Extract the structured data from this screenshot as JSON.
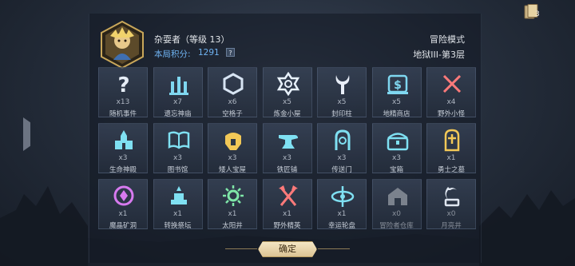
{
  "player": {
    "name": "杂耍者（等级 13）",
    "score_label": "本局积分:",
    "score_value": "1291",
    "help": "?"
  },
  "mode": {
    "title": "冒险模式",
    "floor": "地狱III-第3层"
  },
  "cards": {
    "count": "3"
  },
  "tiles": [
    {
      "count": "x13",
      "label": "随机事件",
      "icon": "question-icon",
      "color": "#e6edf6"
    },
    {
      "count": "x7",
      "label": "遗忘神庙",
      "icon": "temple-icon",
      "color": "#7fd7f0"
    },
    {
      "count": "x6",
      "label": "空格子",
      "icon": "hexagon-icon",
      "color": "#d7e4f3"
    },
    {
      "count": "x5",
      "label": "炼金小屋",
      "icon": "alchemy-icon",
      "color": "#e8f1fb"
    },
    {
      "count": "x5",
      "label": "封印柱",
      "icon": "seal-pillar-icon",
      "color": "#e8eef8"
    },
    {
      "count": "x5",
      "label": "地精商店",
      "icon": "shop-icon",
      "color": "#7fd7f0"
    },
    {
      "count": "x4",
      "label": "野外小怪",
      "icon": "crossed-swords-icon",
      "color": "#ff7a7a"
    },
    {
      "count": "x3",
      "label": "生命神殿",
      "icon": "life-shrine-icon",
      "color": "#7fe0f2"
    },
    {
      "count": "x3",
      "label": "图书馆",
      "icon": "library-icon",
      "color": "#7fe0f2"
    },
    {
      "count": "x3",
      "label": "矮人宝屋",
      "icon": "dwarf-helmet-icon",
      "color": "#f2c857"
    },
    {
      "count": "x3",
      "label": "铁匠铺",
      "icon": "anvil-icon",
      "color": "#7fe0f2"
    },
    {
      "count": "x3",
      "label": "传送门",
      "icon": "portal-icon",
      "color": "#7fe0f2"
    },
    {
      "count": "x3",
      "label": "宝箱",
      "icon": "chest-icon",
      "color": "#7fe0f2"
    },
    {
      "count": "x1",
      "label": "勇士之墓",
      "icon": "tomb-icon",
      "color": "#f2c857"
    },
    {
      "count": "x1",
      "label": "魔晶矿洞",
      "icon": "crystal-mine-icon",
      "color": "#d77aef"
    },
    {
      "count": "x1",
      "label": "转换祭坛",
      "icon": "altar-icon",
      "color": "#7fe0f2"
    },
    {
      "count": "x1",
      "label": "太阳井",
      "icon": "sun-well-icon",
      "color": "#7fe6a8"
    },
    {
      "count": "x1",
      "label": "野外精英",
      "icon": "elite-axes-icon",
      "color": "#ff7a7a"
    },
    {
      "count": "x1",
      "label": "幸运轮盘",
      "icon": "roulette-icon",
      "color": "#7fe0f2"
    },
    {
      "count": "x0",
      "label": "冒险者仓库",
      "icon": "warehouse-icon",
      "color": "#7b828d"
    },
    {
      "count": "x0",
      "label": "月亮井",
      "icon": "moon-well-icon",
      "color": "#dfe6f0"
    }
  ],
  "confirm_label": "确定"
}
